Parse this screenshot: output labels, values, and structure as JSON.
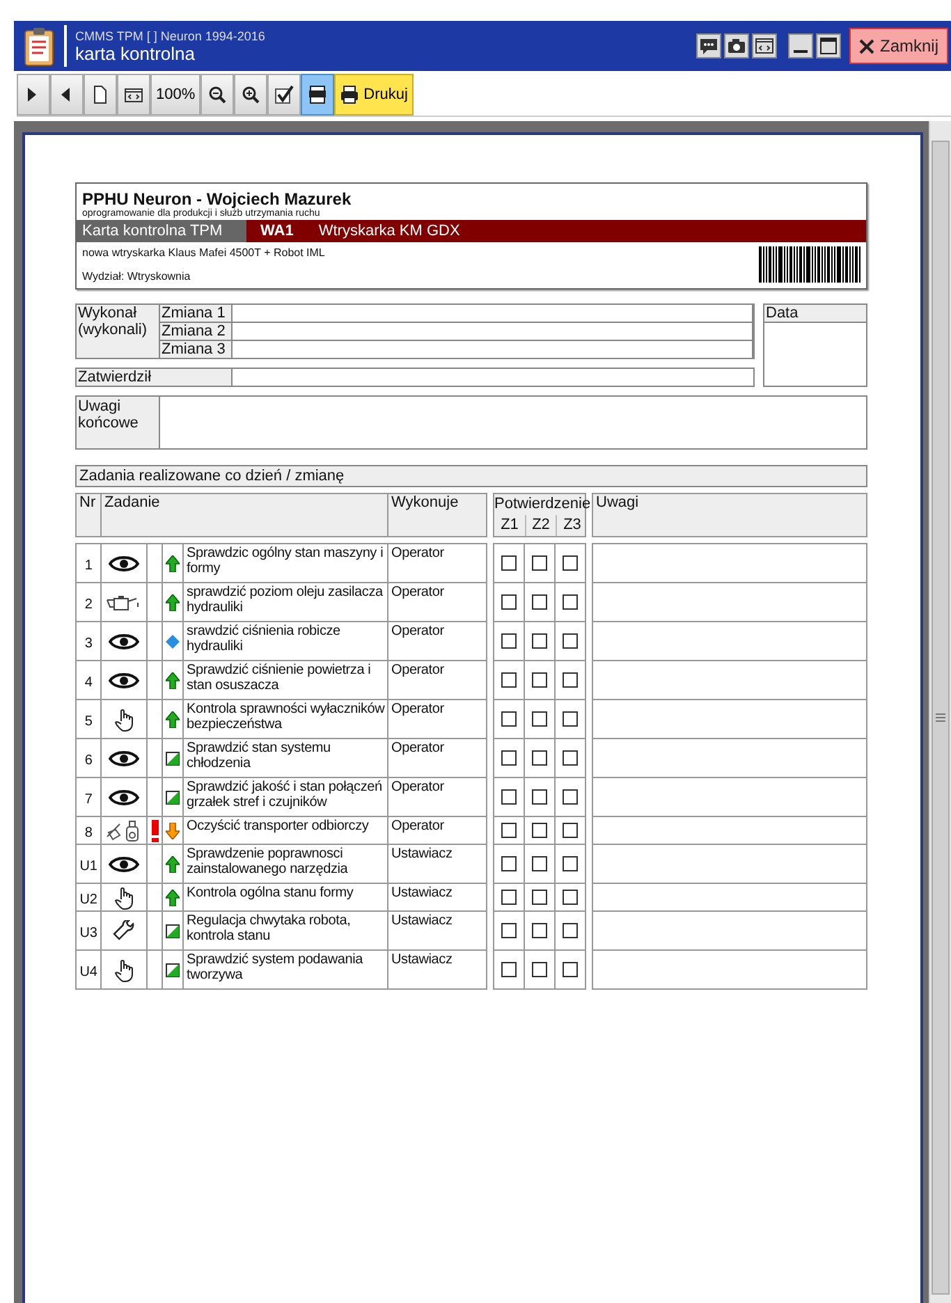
{
  "window": {
    "app": "CMMS TPM  [ ]  Neuron 1994-2016",
    "title": "karta kontrolna",
    "close_label": "Zamknij"
  },
  "toolbar": [
    {
      "kind": "next"
    },
    {
      "kind": "prev"
    },
    {
      "kind": "page"
    },
    {
      "kind": "fit"
    },
    {
      "kind": "text",
      "label": "100%"
    },
    {
      "kind": "zoomout"
    },
    {
      "kind": "zoomin"
    },
    {
      "kind": "check"
    },
    {
      "kind": "pdf",
      "selected": true
    },
    {
      "kind": "print",
      "label": "Drukuj"
    }
  ],
  "header": {
    "company": "PPHU Neuron - Wojciech Mazurek",
    "tagline": "oprogramowanie dla produkcji i służb utrzymania ruchu",
    "card_type": "Karta kontrolna TPM",
    "code": "WA1",
    "machine": "Wtryskarka KM GDX",
    "description": "nowa wtryskarka Klaus Mafei 4500T + Robot IML",
    "department": "Wydział: Wtryskownia"
  },
  "signoff": {
    "done_by": "Wykonał (wykonali)",
    "shifts": [
      "Zmiana 1",
      "Zmiana 2",
      "Zmiana 3"
    ],
    "approved": "Zatwierdził",
    "date": "Data",
    "remarks": "Uwagi końcowe"
  },
  "tasks": {
    "title": "Zadania realizowane co dzień / zmianę",
    "columns": {
      "nr": "Nr",
      "task": "Zadanie",
      "performer": "Wykonuje",
      "confirm": "Potwierdzenie",
      "shifts": [
        "Z1",
        "Z2",
        "Z3"
      ],
      "notes": "Uwagi"
    },
    "rows": [
      {
        "nr": "1",
        "symbol": {
          "kind": "eye"
        },
        "alert": false,
        "marker": {
          "kind": "up"
        },
        "text": "Sprawdzic ogólny stan maszyny i formy",
        "performer": "Operator",
        "checks": [
          false,
          false,
          false
        ]
      },
      {
        "nr": "2",
        "symbol": {
          "kind": "oilcan"
        },
        "alert": false,
        "marker": {
          "kind": "up"
        },
        "text": "sprawdzić poziom oleju  zasilacza hydrauliki",
        "performer": "Operator",
        "checks": [
          false,
          false,
          false
        ]
      },
      {
        "nr": "3",
        "symbol": {
          "kind": "eye"
        },
        "alert": false,
        "marker": {
          "kind": "diamond"
        },
        "text": "srawdzić ciśnienia robicze hydrauliki",
        "performer": "Operator",
        "checks": [
          false,
          false,
          false
        ]
      },
      {
        "nr": "4",
        "symbol": {
          "kind": "eye"
        },
        "alert": false,
        "marker": {
          "kind": "up"
        },
        "text": "Sprawdzić ciśnienie powietrza i stan osuszacza",
        "performer": "Operator",
        "checks": [
          false,
          false,
          false
        ]
      },
      {
        "nr": "5",
        "symbol": {
          "kind": "hand"
        },
        "alert": false,
        "marker": {
          "kind": "up"
        },
        "text": "Kontrola sprawności wyłaczników bezpieczeństwa",
        "performer": "Operator",
        "checks": [
          false,
          false,
          false
        ]
      },
      {
        "nr": "6",
        "symbol": {
          "kind": "eye"
        },
        "alert": false,
        "marker": {
          "kind": "half"
        },
        "text": "Sprawdzić stan systemu chłodzenia",
        "performer": "Operator",
        "checks": [
          false,
          false,
          false
        ]
      },
      {
        "nr": "7",
        "symbol": {
          "kind": "eye"
        },
        "alert": false,
        "marker": {
          "kind": "half"
        },
        "text": "Sprawdzić jakość i stan połączeń grzałek stref i czujników",
        "performer": "Operator",
        "checks": [
          false,
          false,
          false
        ]
      },
      {
        "nr": "8",
        "symbol": {
          "kind": "clean"
        },
        "alert": true,
        "marker": {
          "kind": "down"
        },
        "text": "Oczyścić transporter odbiorczy",
        "performer": "Operator",
        "checks": [
          false,
          false,
          false
        ]
      },
      {
        "nr": "U1",
        "symbol": {
          "kind": "eye"
        },
        "alert": false,
        "marker": {
          "kind": "up"
        },
        "text": "Sprawdzenie poprawnosci zainstalowanego narzędzia",
        "performer": "Ustawiacz",
        "checks": [
          false,
          false,
          false
        ]
      },
      {
        "nr": "U2",
        "symbol": {
          "kind": "hand"
        },
        "alert": false,
        "marker": {
          "kind": "up"
        },
        "text": "Kontrola ogólna stanu formy",
        "performer": "Ustawiacz",
        "checks": [
          false,
          false,
          false
        ]
      },
      {
        "nr": "U3",
        "symbol": {
          "kind": "wrench"
        },
        "alert": false,
        "marker": {
          "kind": "half"
        },
        "text": "Regulacja chwytaka robota, kontrola stanu",
        "performer": "Ustawiacz",
        "checks": [
          false,
          false,
          false
        ]
      },
      {
        "nr": "U4",
        "symbol": {
          "kind": "hand"
        },
        "alert": false,
        "marker": {
          "kind": "half"
        },
        "text": "Sprawdzić system podawania tworzywa",
        "performer": "Ustawiacz",
        "checks": [
          false,
          false,
          false
        ]
      }
    ]
  }
}
